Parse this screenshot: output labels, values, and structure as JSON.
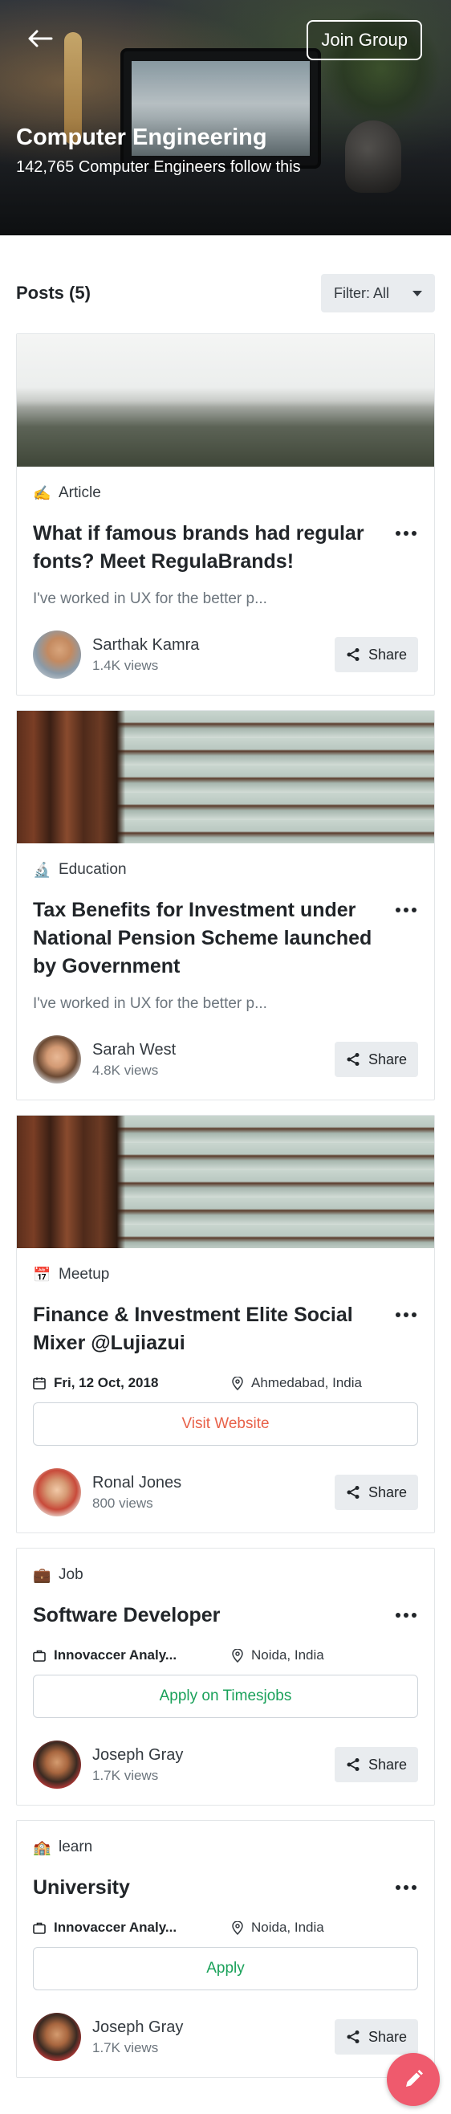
{
  "header": {
    "join_label": "Join Group",
    "title": "Computer Engineering",
    "subtitle": "142,765 Computer Engineers follow this"
  },
  "posts_section": {
    "title": "Posts (5)",
    "filter_label": "Filter: All"
  },
  "posts": [
    {
      "category": "Article",
      "category_icon": "writing-hand-icon",
      "title": "What if famous brands had regular fonts? Meet RegulaBrands!",
      "excerpt": "I've worked in UX for the better p...",
      "author": "Sarthak Kamra",
      "views": "1.4K views",
      "share_label": "Share"
    },
    {
      "category": "Education",
      "category_icon": "microscope-icon",
      "title": "Tax Benefits for Investment under National Pension Scheme launched by Government",
      "excerpt": "I've worked in UX for the better p...",
      "author": "Sarah West",
      "views": "4.8K views",
      "share_label": "Share"
    },
    {
      "category": "Meetup",
      "category_icon": "calendar-icon",
      "title": "Finance & Investment Elite Social Mixer @Lujiazui",
      "date": "Fri, 12 Oct, 2018",
      "location": "Ahmedabad, India",
      "action_label": "Visit Website",
      "author": "Ronal Jones",
      "views": "800 views",
      "share_label": "Share"
    },
    {
      "category": "Job",
      "category_icon": "briefcase-icon",
      "title": "Software Developer",
      "company": "Innovaccer Analy...",
      "location": "Noida, India",
      "action_label": "Apply on Timesjobs",
      "author": "Joseph Gray",
      "views": "1.7K views",
      "share_label": "Share"
    },
    {
      "category": "learn",
      "category_icon": "school-icon",
      "title": "University",
      "company": "Innovaccer Analy...",
      "location": "Noida, India",
      "action_label": "Apply",
      "author": "Joseph Gray",
      "views": "1.7K views",
      "share_label": "Share"
    }
  ],
  "colors": {
    "accent_orange": "#e8624a",
    "accent_green": "#1aa15a",
    "fab": "#ef5a6d"
  }
}
